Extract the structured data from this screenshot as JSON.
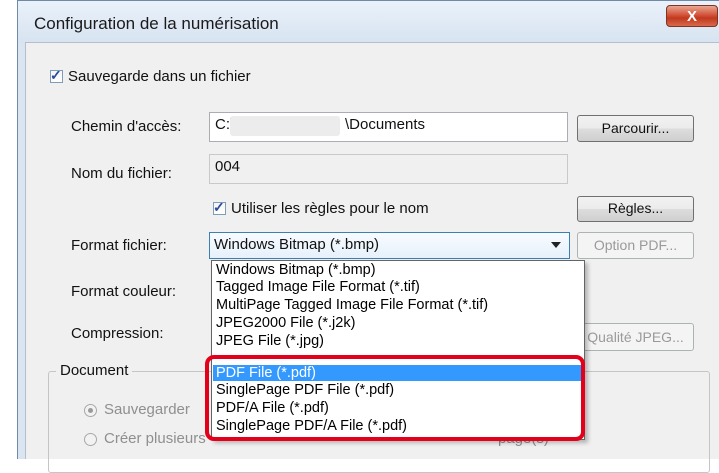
{
  "window": {
    "title": "Configuration de la numérisation",
    "close_label": "X"
  },
  "save_to_file": {
    "label": "Sauvegarde dans un fichier",
    "checked": true
  },
  "path": {
    "label": "Chemin d'accès:",
    "value_prefix": "C:\\",
    "value_suffix": "\\Documents",
    "browse_label": "Parcourir..."
  },
  "filename": {
    "label": "Nom du fichier:",
    "value": "004"
  },
  "naming_rules": {
    "label": "Utiliser les règles pour le nom",
    "checked": true,
    "rules_label": "Règles..."
  },
  "file_format": {
    "label": "Format fichier:",
    "selected": "Windows Bitmap (*.bmp)",
    "pdf_option_label": "Option PDF..."
  },
  "color_format": {
    "label": "Format couleur:"
  },
  "compression": {
    "label": "Compression:",
    "jpeg_quality_label": "Qualité JPEG..."
  },
  "document_group": {
    "title": "Document",
    "save_option_label": "Sauvegarder",
    "multi_option_label": "Créer plusieurs",
    "pages_label": "page(s)"
  },
  "format_options": [
    "Windows Bitmap (*.bmp)",
    "Tagged Image File Format (*.tif)",
    "MultiPage Tagged Image File Format (*.tif)",
    "JPEG2000 File (*.j2k)",
    "JPEG File (*.jpg)",
    "PDF File (*.pdf)",
    "SinglePage PDF File (*.pdf)",
    "PDF/A File (*.pdf)",
    "SinglePage PDF/A File (*.pdf)"
  ],
  "highlighted_option_index": 5,
  "colors": {
    "accent": "#3399ff",
    "highlight_border": "#e3001b"
  }
}
